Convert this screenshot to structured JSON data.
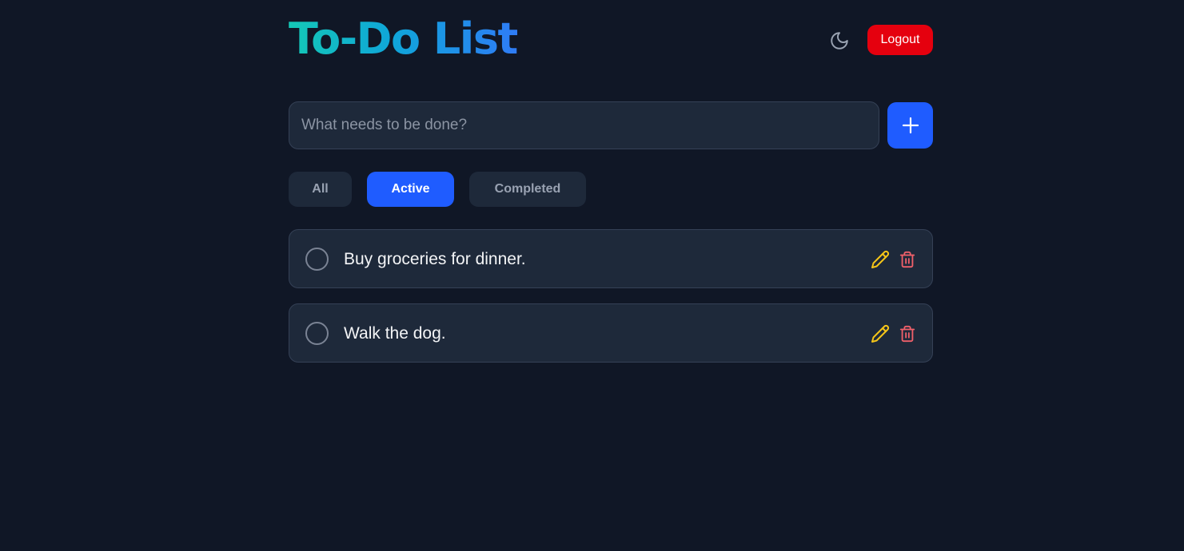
{
  "header": {
    "title": "To-Do List",
    "theme_toggle_icon": "moon-icon",
    "logout_label": "Logout"
  },
  "add_task": {
    "placeholder": "What needs to be done?",
    "value": "",
    "add_icon": "plus-icon"
  },
  "filters": [
    {
      "label": "All",
      "active": false
    },
    {
      "label": "Active",
      "active": true
    },
    {
      "label": "Completed",
      "active": false
    }
  ],
  "todos": [
    {
      "text": "Buy groceries for dinner.",
      "completed": false
    },
    {
      "text": "Walk the dog.",
      "completed": false
    }
  ],
  "colors": {
    "background": "#101726",
    "surface": "#1e293a",
    "accent": "#1f5cff",
    "danger": "#e5000e",
    "edit_icon": "#f5c518",
    "delete_icon": "#f0606a",
    "title_gradient": [
      "#14c8b6",
      "#2f7cf6"
    ]
  }
}
